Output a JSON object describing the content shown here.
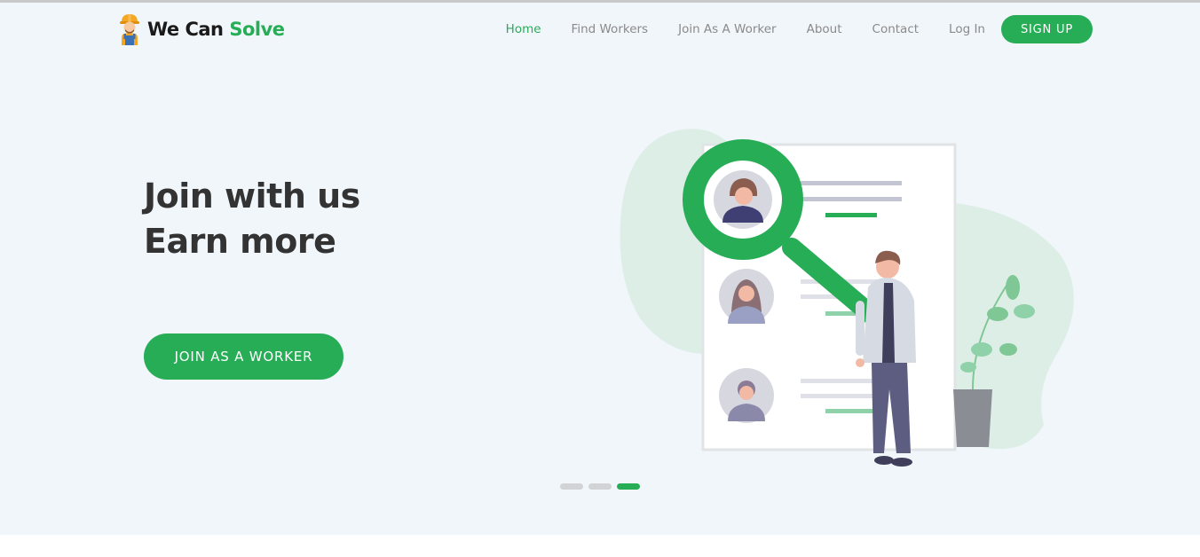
{
  "brand": {
    "word1": "We Can",
    "word2": "Solve",
    "icon": "worker-avatar-icon"
  },
  "nav": {
    "items": [
      {
        "label": "Home",
        "active": true
      },
      {
        "label": "Find Workers",
        "active": false
      },
      {
        "label": "Join As A Worker",
        "active": false
      },
      {
        "label": "About",
        "active": false
      },
      {
        "label": "Contact",
        "active": false
      },
      {
        "label": "Log In",
        "active": false
      }
    ],
    "signup_label": "SIGN UP"
  },
  "hero": {
    "line1": "Join with us",
    "line2": "Earn more",
    "cta_label": "JOIN AS A WORKER",
    "illustration": "recruitment-magnifier-illustration"
  },
  "carousel": {
    "slides": 3,
    "active_index": 2
  },
  "colors": {
    "accent": "#28ad57",
    "heading": "#333333",
    "nav_text": "#8a8a8a",
    "hero_bg": "#f1f6fb"
  }
}
